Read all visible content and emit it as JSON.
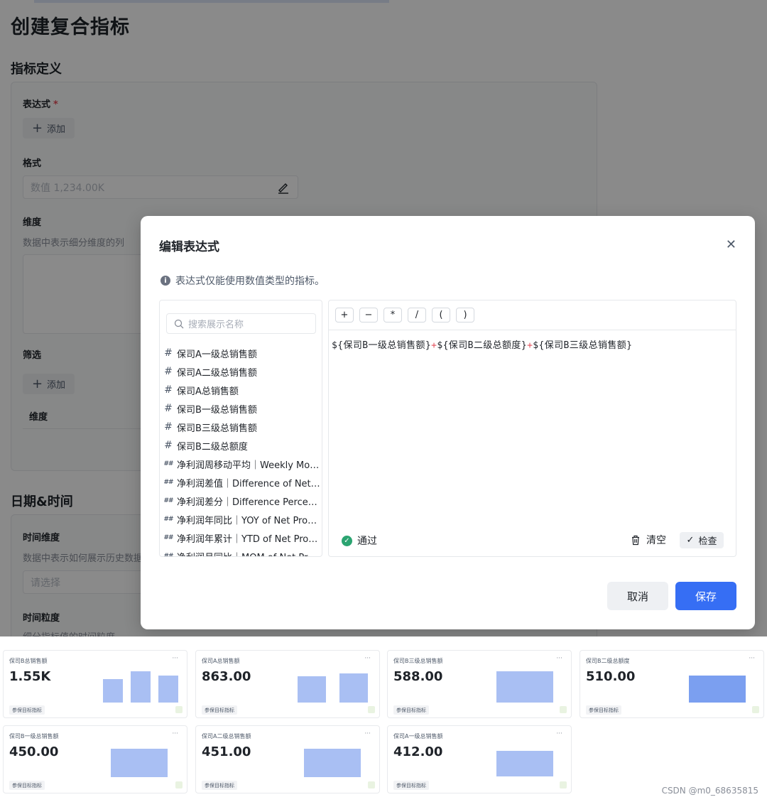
{
  "page": {
    "title": "创建复合指标",
    "section_definition": "指标定义",
    "expression_label": "表达式",
    "required_mark": "*",
    "add_label": "添加",
    "format_label": "格式",
    "format_placeholder": "数值 1,234.00K",
    "dimension_label": "维度",
    "dimension_hint": "数据中表示细分维度的列",
    "filter_label": "筛选",
    "filter_add_label": "添加",
    "filter_col_dimension": "维度",
    "section_datetime": "日期&时间",
    "time_dimension_label": "时间维度",
    "time_dimension_hint": "数据中表示如何展示历史数据",
    "time_dimension_placeholder": "请选择",
    "time_granularity_label": "时间粒度",
    "time_granularity_hint": "细分指标值的时间粒度"
  },
  "modal": {
    "title": "编辑表达式",
    "close_icon": "close-icon",
    "tip": "表达式仅能使用数值类型的指标。",
    "search_placeholder": "搜索展示名称",
    "metrics": [
      {
        "icon": "#",
        "label": "保司A一级总销售额"
      },
      {
        "icon": "#",
        "label": "保司A二级总销售额"
      },
      {
        "icon": "#",
        "label": "保司A总销售额"
      },
      {
        "icon": "#",
        "label": "保司B一级总销售额"
      },
      {
        "icon": "#",
        "label": "保司B三级总销售额"
      },
      {
        "icon": "#",
        "label": "保司B二级总额度"
      },
      {
        "icon": "##",
        "label": "净利润周移动平均｜Weekly Mov..."
      },
      {
        "icon": "##",
        "label": "净利润差值｜Difference of Net P..."
      },
      {
        "icon": "##",
        "label": "净利润差分｜Difference Percent..."
      },
      {
        "icon": "##",
        "label": "净利润年同比｜YOY of Net Profi..."
      },
      {
        "icon": "##",
        "label": "净利润年累计｜YTD of Net Profi..."
      },
      {
        "icon": "##",
        "label": "净利润月同比｜MOM of Net Pro..."
      }
    ],
    "operators": [
      "+",
      "−",
      "*",
      "/",
      "(",
      ")"
    ],
    "expression": {
      "part1": "${保司B一级总销售额}",
      "op1": "+",
      "part2": "${保司B二级总额度}",
      "op2": "+",
      "part3": "${保司B三级总销售额}"
    },
    "status": "通过",
    "clear_label": "清空",
    "check_label": "检查",
    "cancel_label": "取消",
    "save_label": "保存"
  },
  "cards": [
    {
      "title": "保司B总销售额",
      "value": "1.55K",
      "tag": "参保目标指标",
      "more": "···"
    },
    {
      "title": "保司A总销售额",
      "value": "863.00",
      "tag": "参保目标指标",
      "more": "···"
    },
    {
      "title": "保司B三级总销售额",
      "value": "588.00",
      "tag": "参保目标指标",
      "more": "···"
    },
    {
      "title": "保司B二级总额度",
      "value": "510.00",
      "tag": "参保目标指标",
      "more": "···"
    },
    {
      "title": "保司B一级总销售额",
      "value": "450.00",
      "tag": "参保目标指标",
      "more": "···"
    },
    {
      "title": "保司A二级总销售额",
      "value": "451.00",
      "tag": "参保目标指标",
      "more": "···"
    },
    {
      "title": "保司A一级总销售额",
      "value": "412.00",
      "tag": "参保目标指标",
      "more": "···"
    }
  ],
  "watermark": "CSDN @m0_68635815",
  "colors": {
    "primary": "#366ef4",
    "pass": "#2ba471",
    "required": "#e34d59",
    "bar": "#a9bff3"
  }
}
